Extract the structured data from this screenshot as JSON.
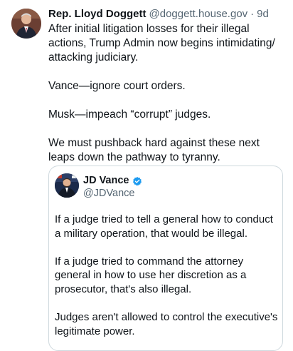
{
  "post": {
    "author_name": "Rep. Lloyd Doggett",
    "author_handle": "@doggett.house.gov",
    "separator": "·",
    "time": "9d",
    "paragraphs": [
      "After initial litigation losses for their illegal actions, Trump Admin now begins intimidating/ attacking judiciary.",
      "Vance—ignore court orders.",
      "Musk—impeach “corrupt” judges.",
      "We must pushback hard against these next leaps down the pathway to tyranny."
    ]
  },
  "quote": {
    "author_name": "JD Vance",
    "author_handle": "@JDVance",
    "verified_icon": "verified-badge-icon",
    "verified_color": "#1d9bf0",
    "paragraphs": [
      "If a judge tried to tell a general how to conduct a military operation, that would be illegal.",
      "If a judge tried to command the attorney general in how to use her discretion as a prosecutor, that's also illegal.",
      "Judges aren't allowed to control the executive's legitimate power."
    ]
  },
  "colors": {
    "text_primary": "#0f1419",
    "text_secondary": "#536471",
    "border": "#cfd9de"
  }
}
